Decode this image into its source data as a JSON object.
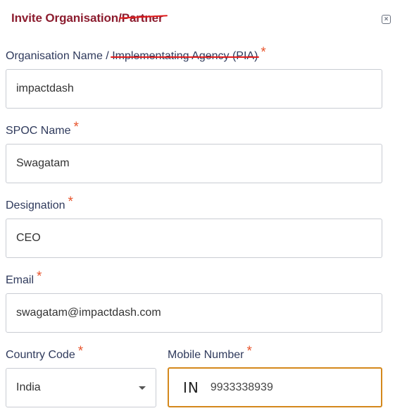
{
  "dialog": {
    "title_prefix": "Invite Organisation/",
    "title_struck": "Partner",
    "close_symbol": "×"
  },
  "fields": {
    "org": {
      "label": "Organisation Name / ",
      "label_struck": "Implementating Agency (PIA)",
      "value": "impactdash"
    },
    "spoc": {
      "label": "SPOC Name",
      "value": "Swagatam"
    },
    "designation": {
      "label": "Designation",
      "value": "CEO"
    },
    "email": {
      "label": "Email",
      "value": "swagatam@impactdash.com"
    },
    "country": {
      "label": "Country Code",
      "value": "India"
    },
    "mobile": {
      "label": "Mobile Number",
      "dial_code": "IN",
      "value": "9933338939"
    }
  },
  "required_marker": "*",
  "colors": {
    "title": "#8c1d2f",
    "required": "#e8542c",
    "strike": "#e01b1b",
    "focus_border": "#d4881c",
    "label": "#2f3a5c"
  }
}
